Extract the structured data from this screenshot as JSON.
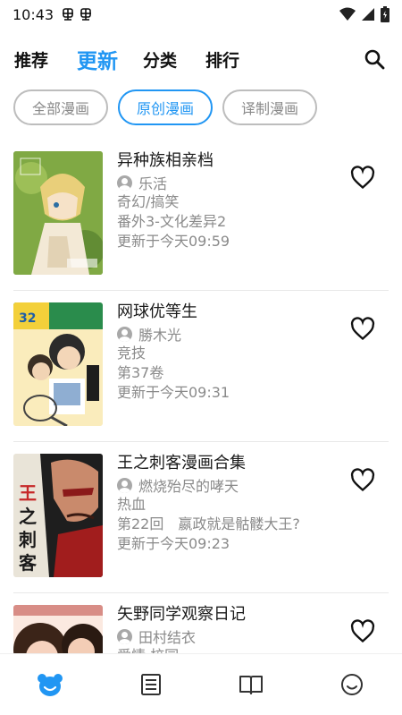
{
  "status_bar": {
    "time": "10:43",
    "notif_icons": [
      "bug-icon",
      "bug-icon"
    ],
    "right_icons": [
      "wifi-icon",
      "signal-icon",
      "battery-icon"
    ]
  },
  "top_tabs": [
    {
      "label": "推荐",
      "active": false
    },
    {
      "label": "更新",
      "active": true
    },
    {
      "label": "分类",
      "active": false
    },
    {
      "label": "排行",
      "active": false
    }
  ],
  "filter_chips": [
    {
      "label": "全部漫画",
      "active": false
    },
    {
      "label": "原创漫画",
      "active": true
    },
    {
      "label": "译制漫画",
      "active": false
    }
  ],
  "comics": [
    {
      "title": "异种族相亲档",
      "author": "乐活",
      "genre": "奇幻/搞笑",
      "chapter": "番外3-文化差异2",
      "updated": "更新于今天09:59"
    },
    {
      "title": "网球优等生",
      "author": "勝木光",
      "genre": "竞技",
      "chapter": "第37卷",
      "updated": "更新于今天09:31"
    },
    {
      "title": "王之刺客漫画合集",
      "author": "燃烧殆尽的哮天",
      "genre": "热血",
      "chapter": "第22回　嬴政就是骷髅大王?",
      "updated": "更新于今天09:23"
    },
    {
      "title": "矢野同学观察日记",
      "author": "田村结衣",
      "genre": "爱情,校园",
      "chapter": "",
      "updated": ""
    }
  ],
  "cover_text": {
    "assassin": [
      "王",
      "之",
      "刺",
      "客"
    ]
  },
  "bottom_nav": [
    {
      "icon": "bear-icon",
      "active": true
    },
    {
      "icon": "list-icon",
      "active": false
    },
    {
      "icon": "book-icon",
      "active": false
    },
    {
      "icon": "smile-icon",
      "active": false
    }
  ],
  "colors": {
    "accent": "#2196f3",
    "muted": "#8a8a8a"
  }
}
